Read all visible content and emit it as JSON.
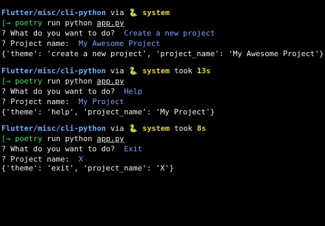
{
  "sessions": [
    {
      "prompt": {
        "path": "Flutter/misc/cli-python",
        "via": " via ",
        "snake": "🐍",
        "env": " system",
        "took": "",
        "duration": ""
      },
      "command": {
        "arrow": "[→",
        "cmd_hl": " poetry",
        "cmd": " run python ",
        "file": "app.py"
      },
      "q1": {
        "marker": "? ",
        "question": "What do you want to do?  ",
        "answer": "Create a new project"
      },
      "q2": {
        "marker": "? ",
        "question": "Project name:  ",
        "answer": "My Awesome Project"
      },
      "output": "{'theme': 'create a new project', 'project_name': 'My Awesome Project'}"
    },
    {
      "prompt": {
        "path": "Flutter/misc/cli-python",
        "via": " via ",
        "snake": "🐍",
        "env": " system",
        "took": " took ",
        "duration": "13s"
      },
      "command": {
        "arrow": "[→",
        "cmd_hl": " poetry",
        "cmd": " run python ",
        "file": "app.py"
      },
      "q1": {
        "marker": "? ",
        "question": "What do you want to do?  ",
        "answer": "Help"
      },
      "q2": {
        "marker": "? ",
        "question": "Project name:  ",
        "answer": "My Project"
      },
      "output": "{'theme': 'help', 'project_name': 'My Project'}"
    },
    {
      "prompt": {
        "path": "Flutter/misc/cli-python",
        "via": " via ",
        "snake": "🐍",
        "env": " system",
        "took": " took ",
        "duration": "8s"
      },
      "command": {
        "arrow": "[→",
        "cmd_hl": " poetry",
        "cmd": " run python ",
        "file": "app.py"
      },
      "q1": {
        "marker": "? ",
        "question": "What do you want to do?  ",
        "answer": "Exit"
      },
      "q2": {
        "marker": "? ",
        "question": "Project name:  ",
        "answer": "X"
      },
      "output": "{'theme': 'exit', 'project_name': 'X'}"
    }
  ]
}
